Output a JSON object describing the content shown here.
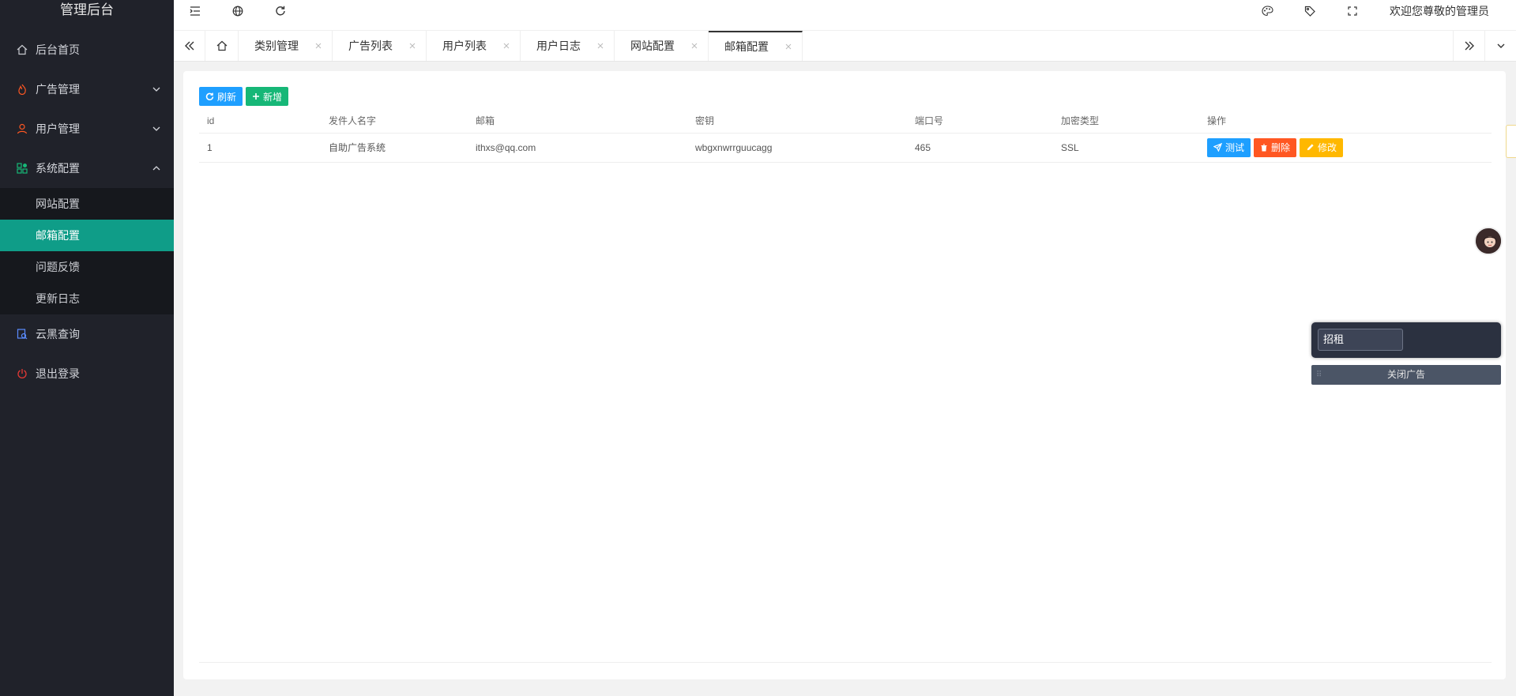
{
  "app": {
    "title": "管理后台"
  },
  "sidebar": {
    "items": [
      {
        "label": "后台首页",
        "icon": "home-icon"
      },
      {
        "label": "广告管理",
        "icon": "fire-icon"
      },
      {
        "label": "用户管理",
        "icon": "user-icon"
      },
      {
        "label": "系统配置",
        "icon": "apps-icon"
      },
      {
        "label": "云黑查询",
        "icon": "search-doc-icon"
      },
      {
        "label": "退出登录",
        "icon": "power-icon"
      }
    ],
    "submenu": [
      {
        "label": "网站配置"
      },
      {
        "label": "邮箱配置"
      },
      {
        "label": "问题反馈"
      },
      {
        "label": "更新日志"
      }
    ]
  },
  "header": {
    "welcome": "欢迎您尊敬的管理员"
  },
  "tabs": [
    {
      "label": "类别管理"
    },
    {
      "label": "广告列表"
    },
    {
      "label": "用户列表"
    },
    {
      "label": "用户日志"
    },
    {
      "label": "网站配置"
    },
    {
      "label": "邮箱配置"
    }
  ],
  "toolbar": {
    "refresh_label": "刷新",
    "add_label": "新增"
  },
  "table": {
    "columns": [
      "id",
      "发件人名字",
      "邮箱",
      "密钥",
      "端口号",
      "加密类型",
      "操作"
    ],
    "rows": [
      {
        "id": "1",
        "sender": "自助广告系统",
        "email": "ithxs@qq.com",
        "key": "wbgxnwrrguucagg",
        "port": "465",
        "encryption": "SSL"
      }
    ],
    "actions": {
      "test": "测试",
      "delete": "删除",
      "edit": "修改"
    }
  },
  "ad": {
    "input_value": "招租",
    "close_label": "关闭广告"
  },
  "colors": {
    "sidebar_bg": "#20222a",
    "active": "#0f9d88",
    "blue": "#1e9fff",
    "green": "#16b777",
    "red": "#ff5722",
    "orange": "#ffb800"
  }
}
